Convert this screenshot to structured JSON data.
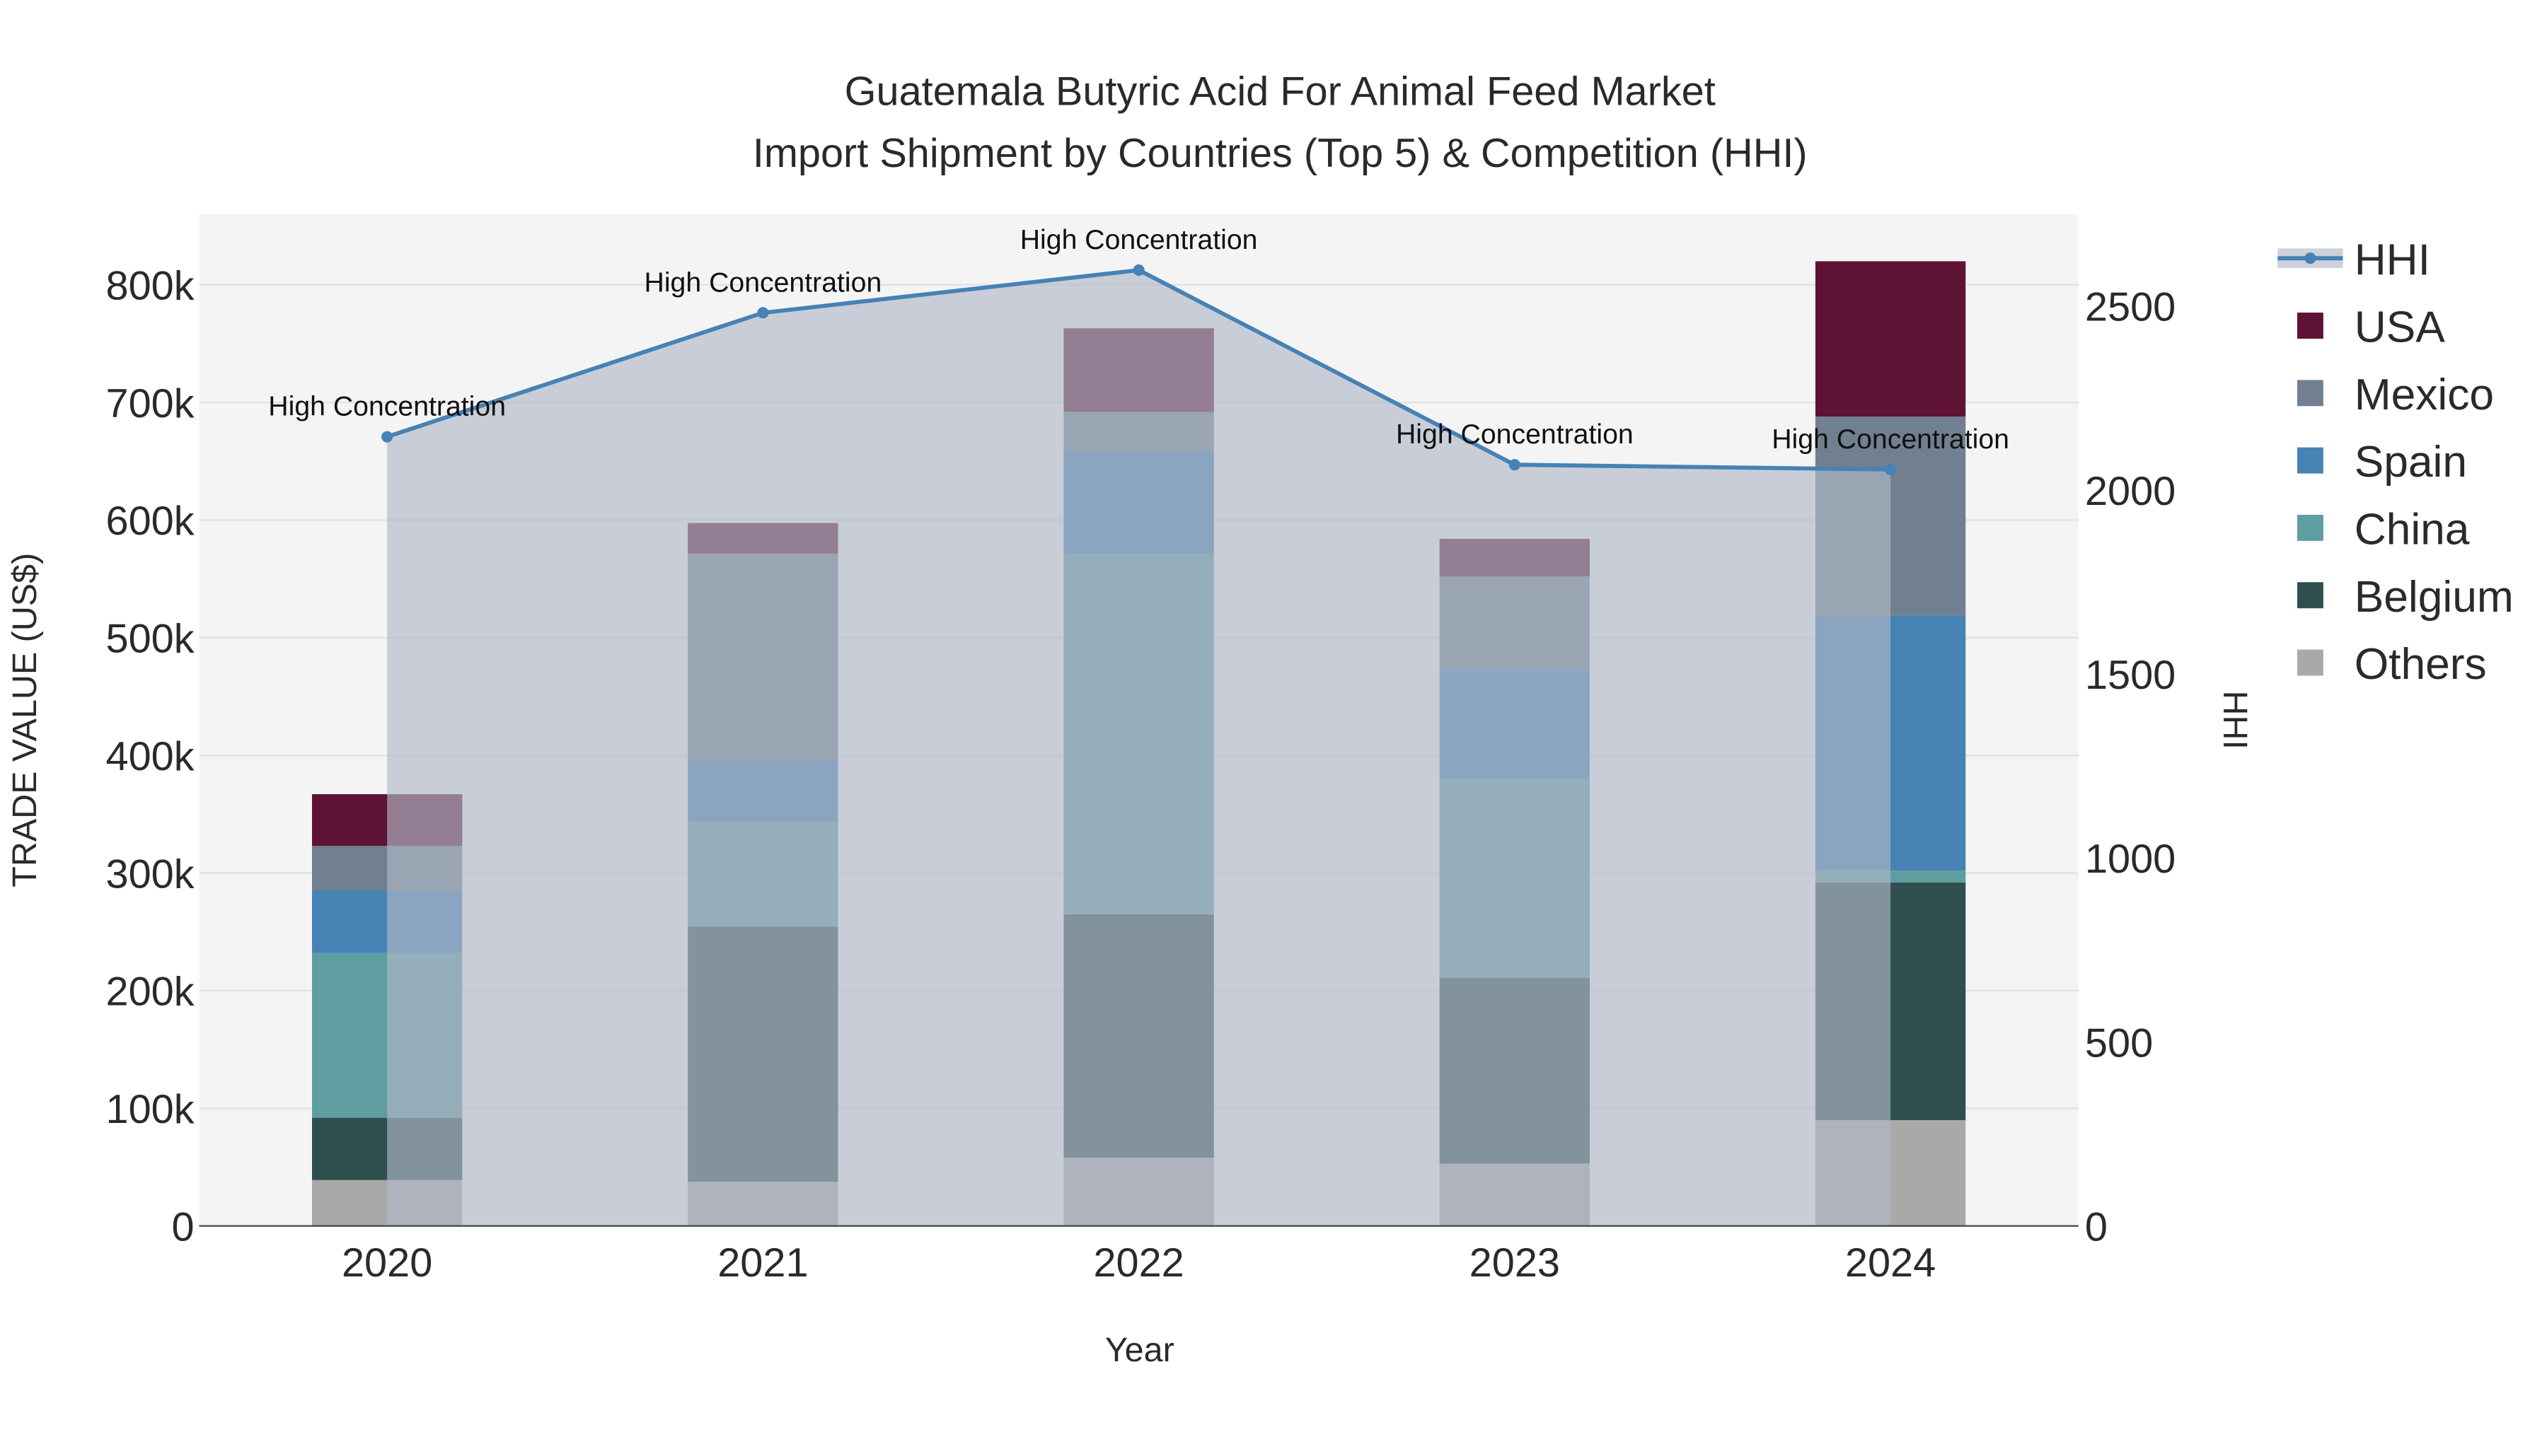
{
  "chart_data": {
    "type": "bar",
    "stacked": true,
    "title": "Guatemala Butyric Acid For Animal Feed Market",
    "subtitle": "Import Shipment by Countries (Top 5) & Competition (HHI)",
    "xlabel": "Year",
    "ylabel": "TRADE VALUE (US$)",
    "y2label": "HHI",
    "categories": [
      "2020",
      "2021",
      "2022",
      "2023",
      "2024"
    ],
    "ylim": [
      0,
      860000
    ],
    "y_ticks": [
      0,
      100000,
      200000,
      300000,
      400000,
      500000,
      600000,
      700000,
      800000
    ],
    "y_tick_labels": [
      "0",
      "100k",
      "200k",
      "300k",
      "400k",
      "500k",
      "600k",
      "700k",
      "800k"
    ],
    "y2lim": [
      0,
      2750
    ],
    "y2_ticks": [
      0,
      500,
      1000,
      1500,
      2000,
      2500
    ],
    "y2_tick_labels": [
      "0",
      "500",
      "1000",
      "1500",
      "2000",
      "2500"
    ],
    "series": [
      {
        "name": "Others",
        "color": "#a9a9a9",
        "values": [
          39000,
          37500,
          58000,
          53000,
          90000
        ]
      },
      {
        "name": "Belgium",
        "color": "#2f4f4f",
        "values": [
          53000,
          217000,
          207000,
          158000,
          202000
        ]
      },
      {
        "name": "China",
        "color": "#5f9ea0",
        "values": [
          140000,
          89000,
          306000,
          169000,
          10000
        ]
      },
      {
        "name": "Spain",
        "color": "#4682b4",
        "values": [
          53000,
          53000,
          88000,
          93000,
          217000
        ]
      },
      {
        "name": "Mexico",
        "color": "#708090",
        "values": [
          38000,
          175000,
          33000,
          79000,
          169000
        ]
      },
      {
        "name": "USA",
        "color": "#5e1234",
        "values": [
          44000,
          26000,
          71000,
          32000,
          132000
        ]
      }
    ],
    "line": {
      "name": "HHI",
      "color": "#4682b4",
      "values": [
        2145,
        2482,
        2598,
        2069,
        2056
      ],
      "annotations": [
        "High Concentration",
        "High Concentration",
        "High Concentration",
        "High Concentration",
        "High Concentration"
      ]
    },
    "legend": [
      "HHI",
      "USA",
      "Mexico",
      "Spain",
      "China",
      "Belgium",
      "Others"
    ],
    "legend_position": "right",
    "grid": true
  }
}
